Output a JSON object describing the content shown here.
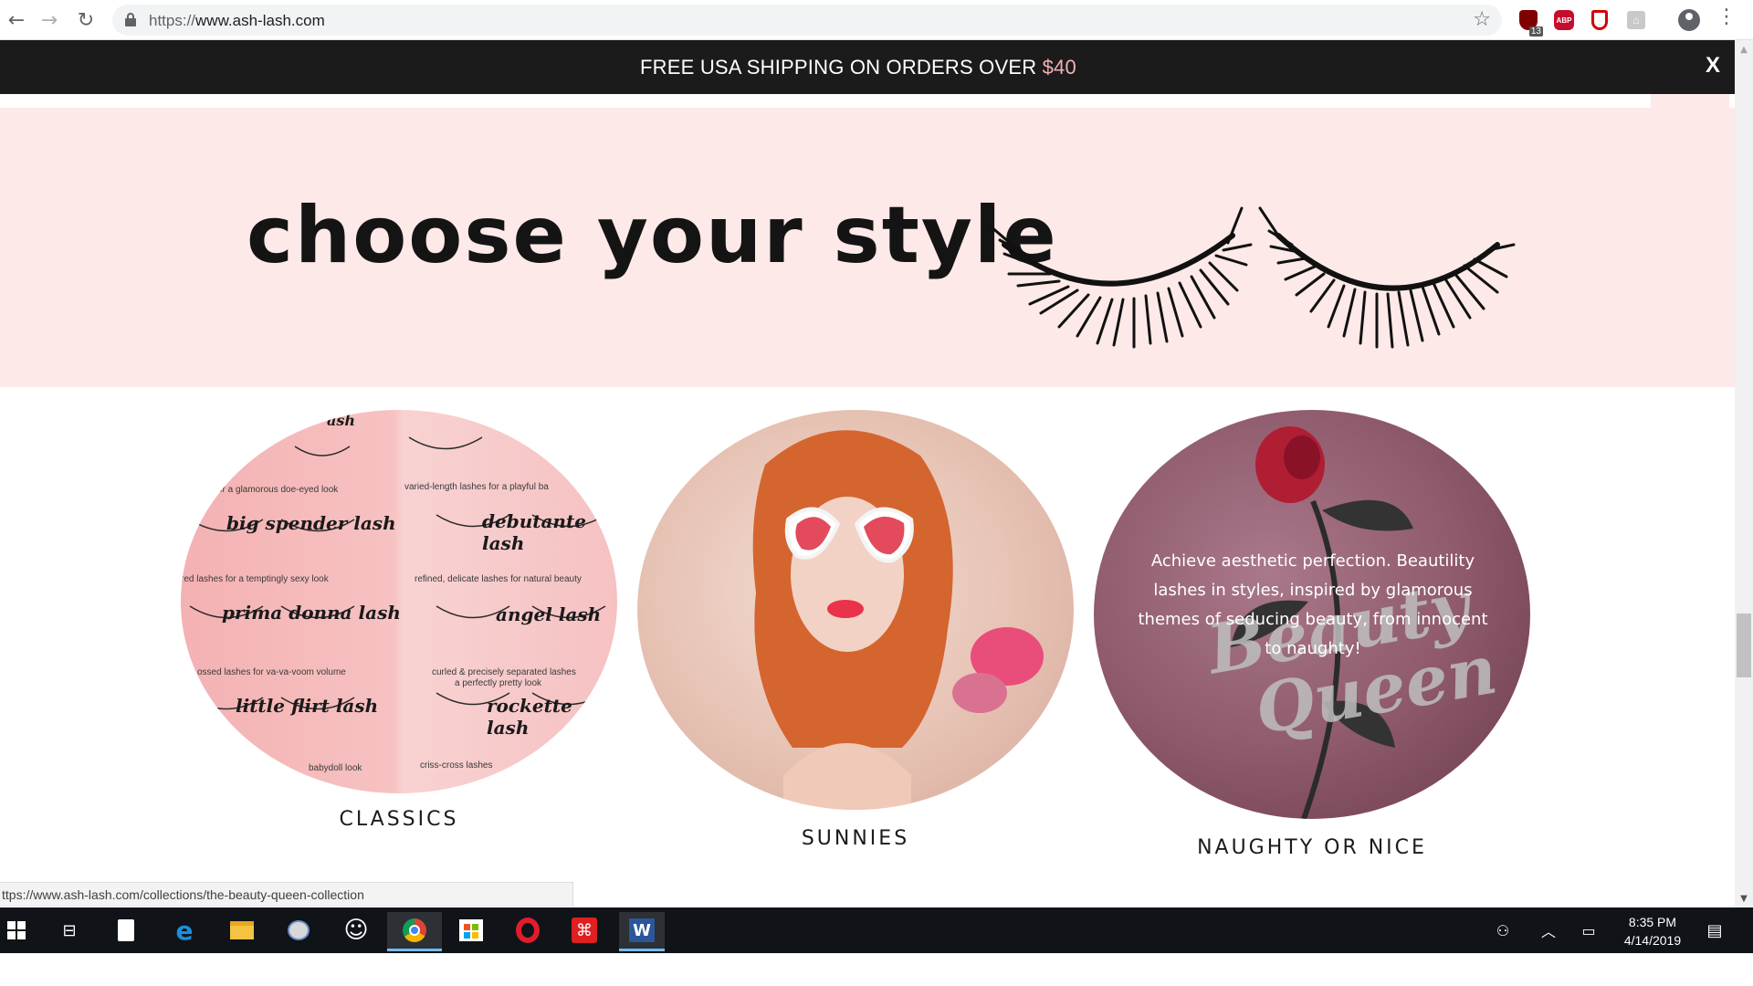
{
  "browser": {
    "url_scheme": "https://",
    "url_host": "www.ash-lash.com",
    "extensions": {
      "ublock_badge": "13",
      "abp_label": "ABP"
    }
  },
  "announcement": {
    "text": "FREE USA SHIPPING ON ORDERS OVER ",
    "amount": "$40",
    "close_label": "X"
  },
  "hero": {
    "title": "choose your style"
  },
  "collections": [
    {
      "label": "CLASSICS"
    },
    {
      "label": "SUNNIES"
    },
    {
      "label": "NAUGHTY OR NICE",
      "overlay_text": "Achieve aesthetic perfection. Beautility lashes in styles, inspired by glamorous themes of seducing beauty, from innocent to naughty!",
      "script_line1": "Beauty",
      "script_line2": "Queen"
    }
  ],
  "classics_card": {
    "names": [
      "big spender lash",
      "debutante lash",
      "prima donna lash",
      "angel lash",
      "little flirt lash",
      "rockette lash"
    ],
    "captions": [
      "or a glamorous doe-eyed look",
      "varied-length lashes for a playful ba",
      "red lashes for a temptingly sexy look",
      "refined, delicate lashes for natural beauty",
      "ossed lashes for va-va-voom volume",
      "curled & precisely separated lashes",
      "a perfectly pretty look",
      "babydoll look",
      "criss-cross lashes"
    ],
    "top_fragment": "ash"
  },
  "status_bar": {
    "url": "ttps://www.ash-lash.com/collections/the-beauty-queen-collection"
  },
  "taskbar": {
    "time": "8:35 PM",
    "date": "4/14/2019"
  }
}
